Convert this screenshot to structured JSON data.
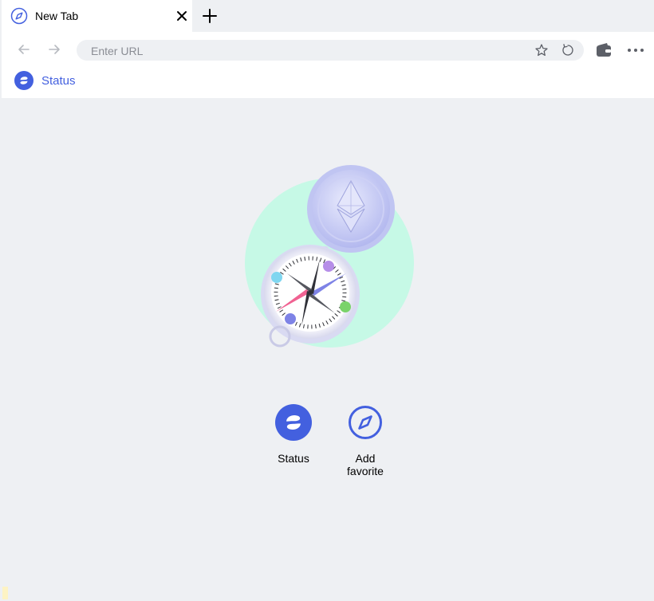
{
  "tab": {
    "title": "New Tab"
  },
  "toolbar": {
    "url_placeholder": "Enter URL",
    "url_value": ""
  },
  "bookmarks": [
    {
      "label": "Status"
    }
  ],
  "favorites": [
    {
      "label": "Status"
    },
    {
      "label": "Add favorite"
    }
  ],
  "colors": {
    "accent": "#4360df",
    "background": "#eef0f3",
    "mint": "#c6f9e6"
  }
}
